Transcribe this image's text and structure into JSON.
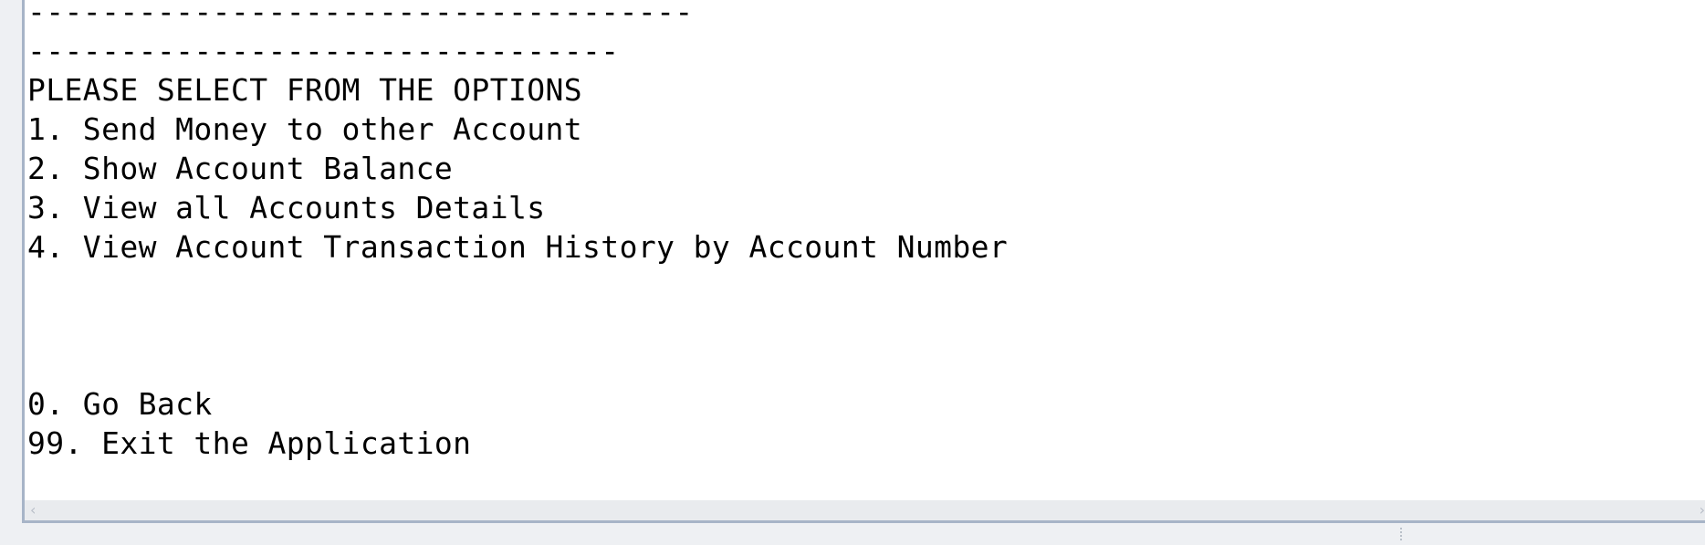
{
  "console": {
    "lines": [
      "------------------------------------",
      "--------------------------------",
      "PLEASE SELECT FROM THE OPTIONS",
      "1. Send Money to other Account",
      "2. Show Account Balance",
      "3. View all Accounts Details",
      "4. View Account Transaction History by Account Number",
      "",
      "",
      "",
      "0. Go Back",
      "99. Exit the Application"
    ]
  },
  "scrollbar": {
    "left_arrow_icon": "chevron-left-icon",
    "right_arrow_icon": "chevron-right-icon",
    "left_arrow_glyph": "‹",
    "right_arrow_glyph": "›"
  },
  "colors": {
    "background": "#ffffff",
    "text": "#000000",
    "border": "#a7b4c7",
    "scrollbar": "#e9ebee"
  }
}
